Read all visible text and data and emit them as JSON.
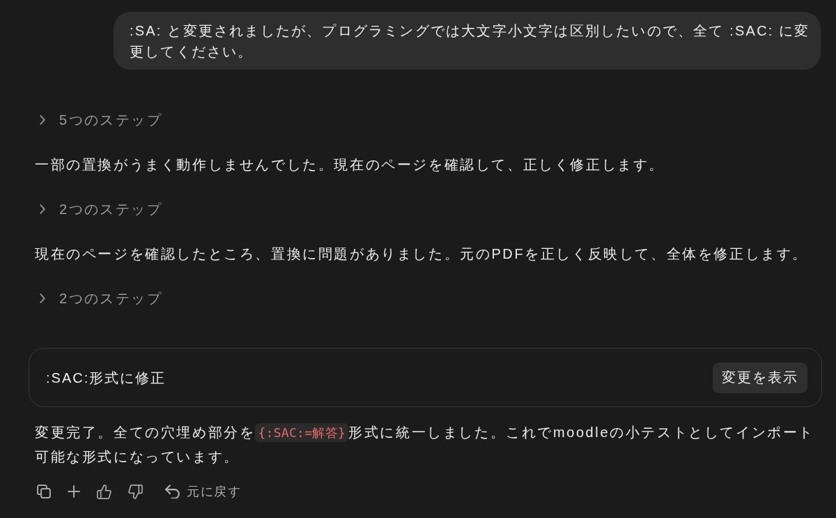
{
  "user_message": {
    "text": ":SA: と変更されましたが、プログラミングでは大文字小文字は区別したいので、全て :SAC: に変更してください。"
  },
  "conversation": [
    {
      "kind": "steps",
      "label": "5つのステップ",
      "expanded": false
    },
    {
      "kind": "text",
      "text": "一部の置換がうまく動作しませんでした。現在のページを確認して、正しく修正します。"
    },
    {
      "kind": "steps",
      "label": "2つのステップ",
      "expanded": false
    },
    {
      "kind": "text",
      "text": "現在のページを確認したところ、置換に問題がありました。元のPDFを正しく反映して、全体を修正します。"
    },
    {
      "kind": "steps",
      "label": "2つのステップ",
      "expanded": false
    }
  ],
  "artifact_card": {
    "title": ":SAC:形式に修正",
    "button": "変更を表示"
  },
  "response": {
    "parts": [
      {
        "kind": "text",
        "text": "変更完了。全ての穴埋め部分を"
      },
      {
        "kind": "code",
        "text": "{:SAC:=解答}"
      },
      {
        "kind": "text",
        "text": "形式に統一しました。これでmoodleの小テストとしてインポート可能な形式になっています。"
      }
    ]
  },
  "action_bar": {
    "undo_label": "元に戻す"
  }
}
